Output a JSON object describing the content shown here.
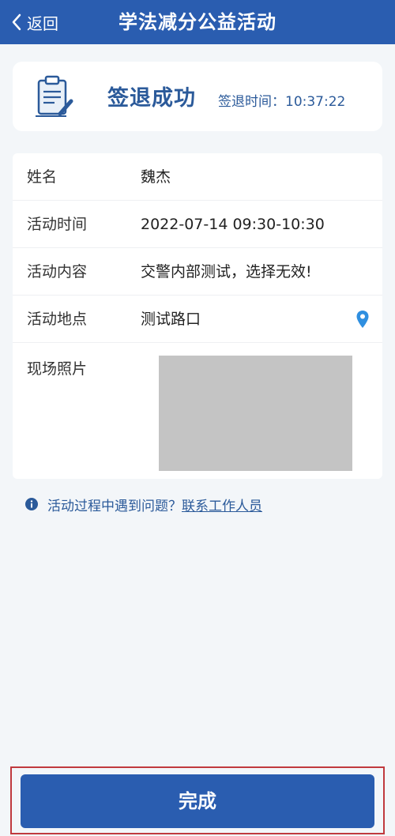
{
  "navbar": {
    "back_label": "返回",
    "title": "学法减分公益活动"
  },
  "status": {
    "title": "签退成功",
    "time_label": "签退时间：",
    "time_value": "10:37:22"
  },
  "info": {
    "rows": [
      {
        "label": "姓名",
        "value": "魏杰"
      },
      {
        "label": "活动时间",
        "value": "2022-07-14 09:30-10:30"
      },
      {
        "label": "活动内容",
        "value": "交警内部测试，选择无效!"
      },
      {
        "label": "活动地点",
        "value": "测试路口"
      }
    ],
    "photo_label": "现场照片"
  },
  "help": {
    "text": "活动过程中遇到问题？",
    "link": "联系工作人员"
  },
  "footer": {
    "done_label": "完成"
  },
  "colors": {
    "primary": "#2a5db0",
    "text_accent": "#2b5a9a",
    "highlight_border": "#c0393e"
  },
  "icons": {
    "back": "chevron-left-icon",
    "status": "clipboard-pen-icon",
    "location": "map-pin-icon",
    "info": "info-icon"
  }
}
